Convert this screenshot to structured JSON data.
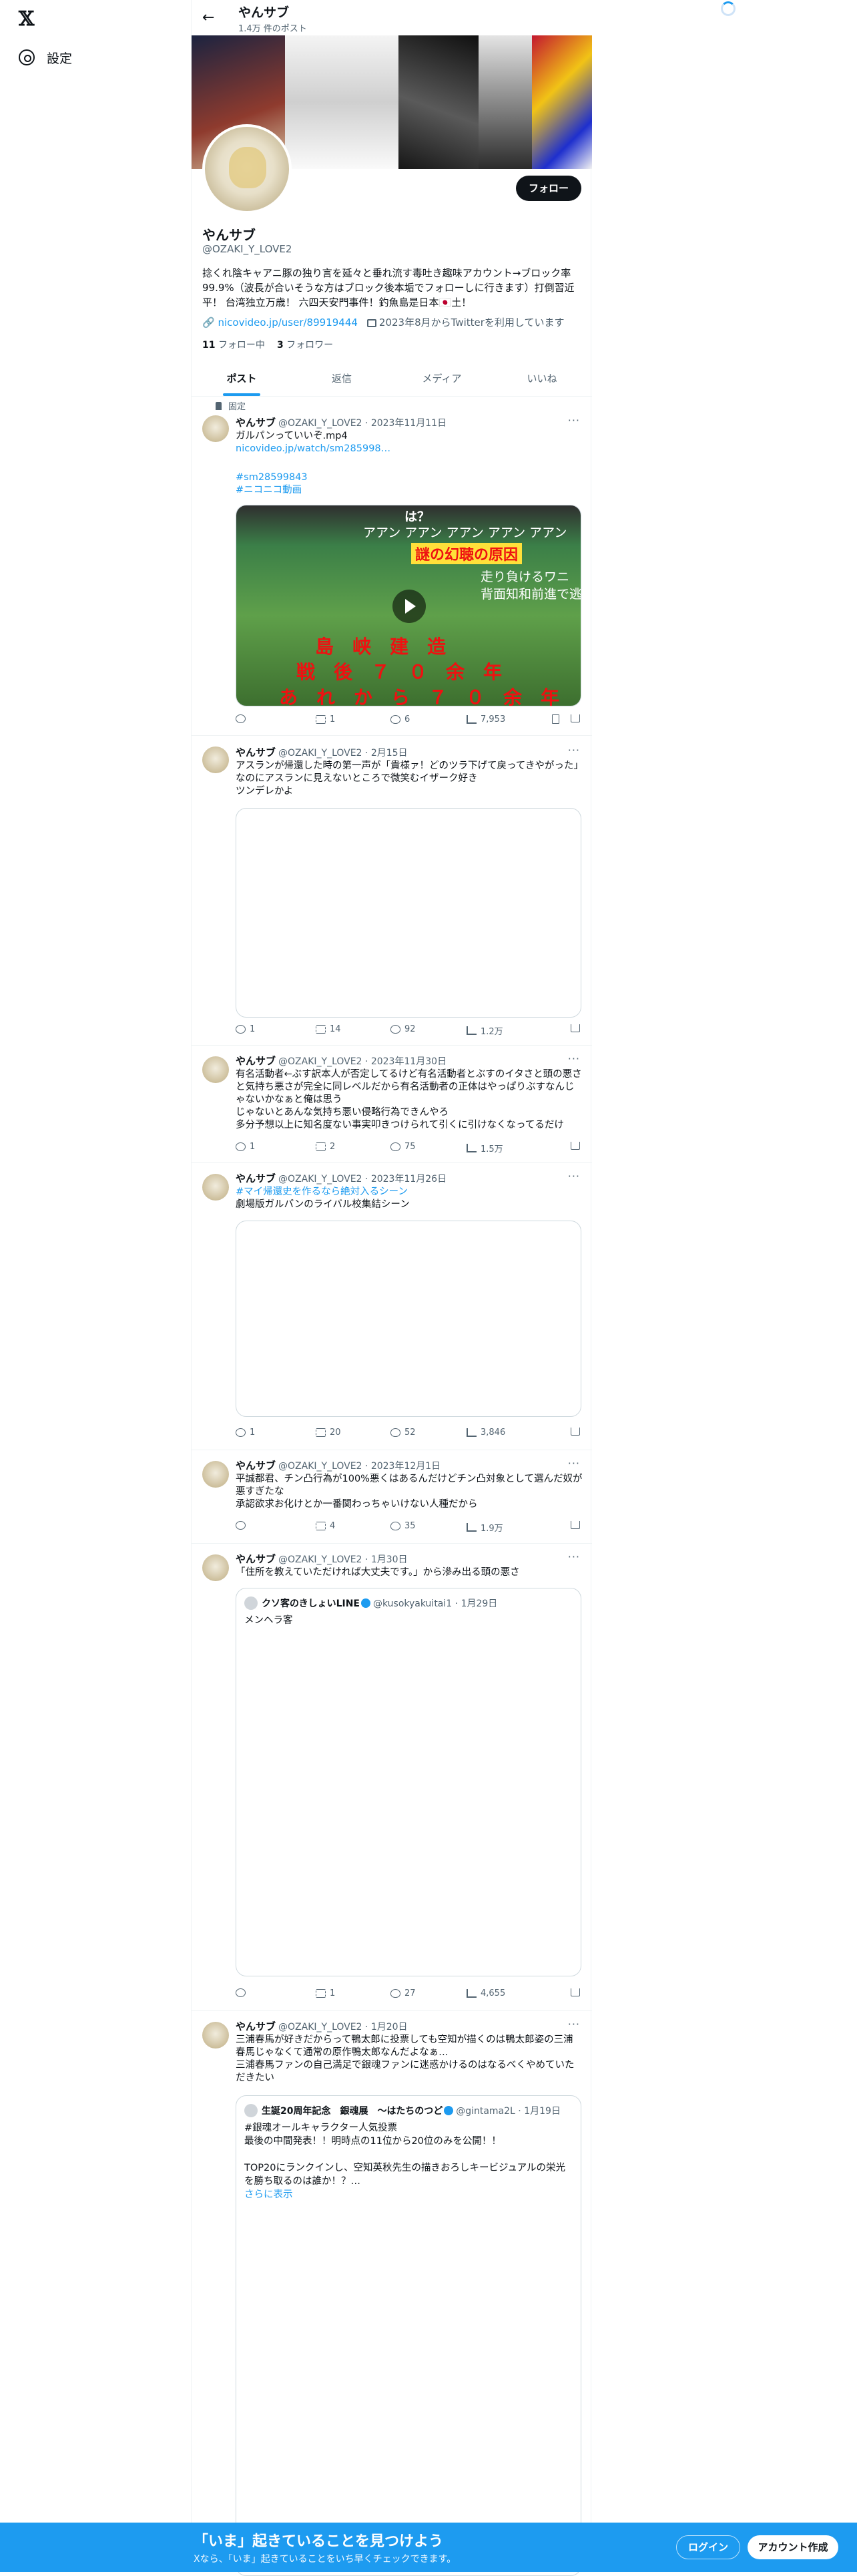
{
  "leftnav": {
    "logo": "𝕏",
    "settings_label": "設定"
  },
  "header": {
    "name": "やんサブ",
    "post_count": "1.4万 件のポスト"
  },
  "profile": {
    "follow_label": "フォロー",
    "display_name": "やんサブ",
    "handle": "@OZAKI_Y_LOVE2",
    "bio": "捻くれ陰キャアニ豚の独り言を延々と垂れ流す毒吐き趣味アカウント→ブロック率99.9%（波長が合いそうな方はブロック後本垢でフォローしに行きます）打倒習近平！ 台湾独立万歳！ 六四天安門事件！釣魚島是日本🇯🇵土！",
    "link": "nicovideo.jp/user/89919444",
    "joined": "2023年8月からTwitterを利用しています",
    "following_count": "11",
    "following_label": "フォロー中",
    "followers_count": "3",
    "followers_label": "フォロワー"
  },
  "tabs": [
    "ポスト",
    "返信",
    "メディア",
    "いいね"
  ],
  "pinned_label": "固定",
  "tweets": [
    {
      "name": "やんサブ",
      "handle": "@OZAKI_Y_LOVE2",
      "date": "2023年11月11日",
      "text": "ガルパンっていいぞ.mp4",
      "link1": "nicovideo.jp/watch/sm285998…",
      "link2": "#sm28599843",
      "link3": "#ニコニコ動画",
      "video_caption_1": "は？",
      "video_caption_2": "アアン アアン アアン アアン アアン",
      "video_caption_3": "謎の幻聴の原因",
      "video_caption_4": "走り負けるワニ",
      "video_caption_5": "背面知和前進で逃",
      "video_caption_6": "島　峡　建　造",
      "video_caption_7": "戦　後　７　０　余　年",
      "video_caption_8": "あ　れ　か　ら　７　０　余　年",
      "reply": "",
      "rt": "1",
      "like": "6",
      "views": "7,953"
    },
    {
      "name": "やんサブ",
      "handle": "@OZAKI_Y_LOVE2",
      "date": "2月15日",
      "text": "アスランが帰還した時の第一声が「貴様ァ！どのツラ下げて戻ってきやがった」なのにアスランに見えないところで微笑むイザーク好き\nツンデレかよ",
      "reply": "1",
      "rt": "14",
      "like": "92",
      "views": "1.2万"
    },
    {
      "name": "やんサブ",
      "handle": "@OZAKI_Y_LOVE2",
      "date": "2023年11月30日",
      "text": "有名活動者←ぶす訳本人が否定してるけど有名活動者とぶすのイタさと頭の悪さと気持ち悪さが完全に同レベルだから有名活動者の正体はやっぱりぶすなんじゃないかなぁと俺は思う\nじゃないとあんな気持ち悪い侵略行為できんやろ\n多分予想以上に知名度ない事実叩きつけられて引くに引けなくなってるだけ",
      "reply": "1",
      "rt": "2",
      "like": "75",
      "views": "1.5万"
    },
    {
      "name": "やんサブ",
      "handle": "@OZAKI_Y_LOVE2",
      "date": "2023年11月26日",
      "hashtag": "#マイ帰還史を作るなら絶対入るシーン",
      "text": "劇場版ガルパンのライバル校集結シーン",
      "reply": "1",
      "rt": "20",
      "like": "52",
      "views": "3,846"
    },
    {
      "name": "やんサブ",
      "handle": "@OZAKI_Y_LOVE2",
      "date": "2023年12月1日",
      "text": "平誠都君、チン凸行為が100%悪くはあるんだけどチン凸対象として選んだ奴が悪すぎたな\n承認欲求お化けとか一番関わっちゃいけない人種だから",
      "reply": "",
      "rt": "4",
      "like": "35",
      "views": "1.9万"
    },
    {
      "name": "やんサブ",
      "handle": "@OZAKI_Y_LOVE2",
      "date": "1月30日",
      "text": "「住所を教えていただければ大丈夫です。」から滲み出る頭の悪さ",
      "quote_name": "クソ客のきしょいLINE",
      "quote_handle": "@kusokyakuitai1",
      "quote_date": "1月29日",
      "quote_text": "メンヘラ客",
      "reply": "",
      "rt": "1",
      "like": "27",
      "views": "4,655"
    },
    {
      "name": "やんサブ",
      "handle": "@OZAKI_Y_LOVE2",
      "date": "1月20日",
      "text": "三浦春馬が好きだからって鴨太郎に投票しても空知が描くのは鴨太郎姿の三浦春馬じゃなくて通常の原作鴨太郎なんだよなぁ…\n三浦春馬ファンの自己満足で銀魂ファンに迷惑かけるのはなるべくやめていただきたい",
      "quote_name": "生誕20周年記念　銀魂展　〜はたちのつど",
      "quote_handle": "@gintama2L",
      "quote_date": "1月19日",
      "quote_text": "#銀魂オールキャラクター人気投票\n最後の中間発表！！明時点の11位から20位のみを公開！！\n\nTOP20にランクインし、空知英秋先生の描きおろしキービジュアルの栄光を勝ち取るのは誰か！？…",
      "quote_more": "さらに表示"
    }
  ],
  "bottom": {
    "title": "「いま」起きていることを見つけよう",
    "subtitle": "Xなら、「いま」起きていることをいち早くチェックできます。",
    "login": "ログイン",
    "signup": "アカウント作成"
  },
  "colors": {
    "accent": "#1d9bf0",
    "text": "#0f1419",
    "muted": "#536471"
  }
}
